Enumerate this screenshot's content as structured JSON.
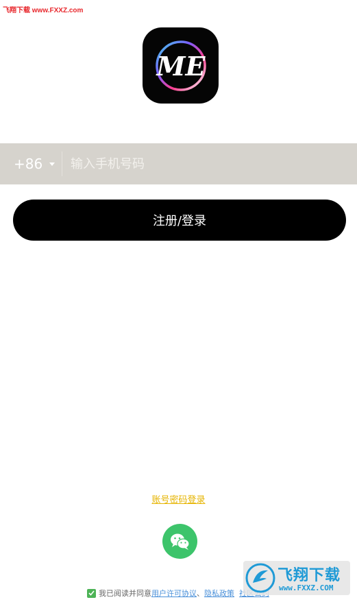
{
  "watermark": {
    "top_text": "飞翔下载 www.FXXZ.com",
    "badge_title": "飞翔下载",
    "badge_site": "www.FXXZ.COM"
  },
  "app": {
    "logo_text": "ME",
    "logo_icon": "me-logo-icon"
  },
  "phone": {
    "country_code": "+86",
    "placeholder": "输入手机号码",
    "value": ""
  },
  "actions": {
    "register_login_label": "注册/登录",
    "password_login_label": "账号密码登录",
    "wechat_icon": "wechat-icon"
  },
  "agreement": {
    "prefix": "我已阅读并同意",
    "user_agreement": "用户许可协议",
    "separator": "、",
    "privacy_policy": "隐私政策",
    "extra_link": "社区公约",
    "checked": true
  },
  "colors": {
    "primary": "#000000",
    "phone_bar": "#d6d3cd",
    "link_yellow": "#e6b400",
    "wechat_green": "#3dc46b",
    "link_blue": "#4a90d9"
  }
}
